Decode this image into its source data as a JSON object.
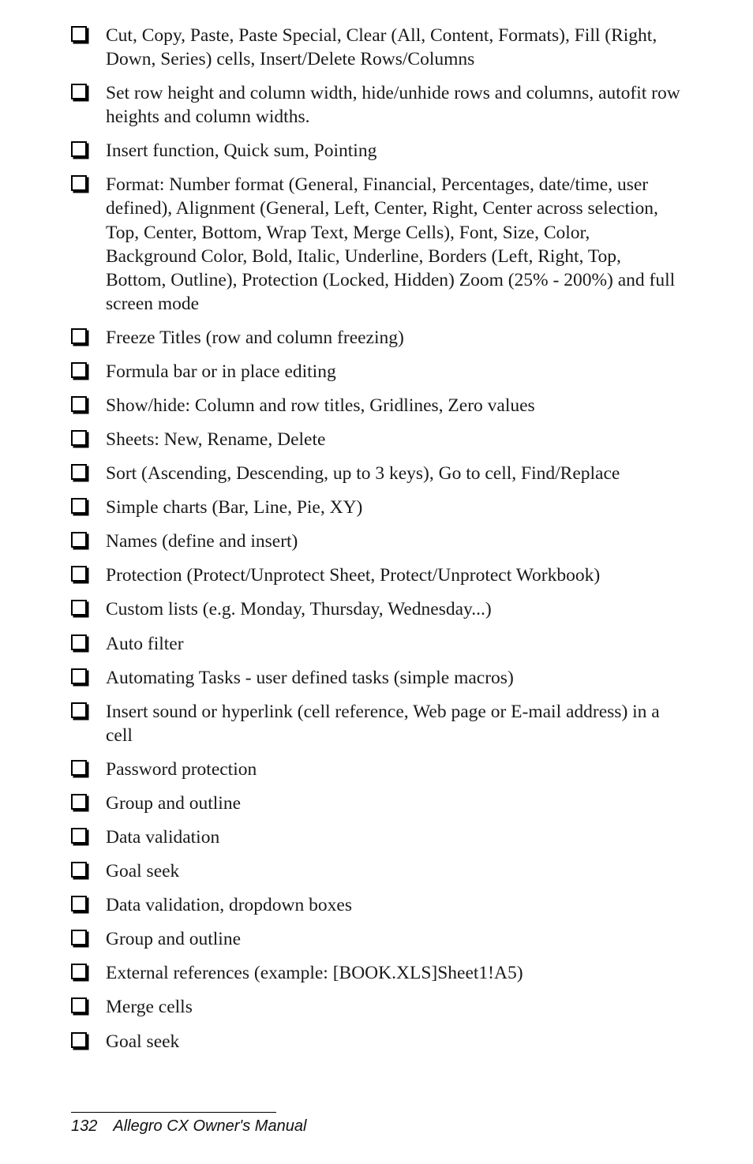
{
  "items": [
    "Cut, Copy, Paste, Paste Special, Clear (All, Content, Formats), Fill (Right, Down, Series) cells, Insert/Delete Rows/Columns",
    "Set row height and column width, hide/unhide rows and columns, autofit row heights and column widths.",
    "Insert function, Quick sum, Pointing",
    "Format: Number format (General, Financial, Percentages, date/time, user defined),   Alignment (General, Left, Center, Right, Center across selection, Top, Center, Bottom,  Wrap Text, Merge Cells), Font, Size, Color, Background Color, Bold, Italic, Underline, Borders (Left, Right, Top, Bottom, Outline), Protection (Locked, Hidden)  Zoom (25% - 200%) and full screen mode",
    "Freeze Titles (row and column freezing)",
    "Formula bar or in place editing",
    "Show/hide: Column and row titles, Gridlines, Zero values",
    "Sheets: New, Rename, Delete",
    "Sort (Ascending, Descending, up to 3 keys), Go to cell, Find/Replace",
    "Simple charts (Bar, Line, Pie, XY)",
    "Names (define and insert)",
    "Protection (Protect/Unprotect Sheet, Protect/Unprotect Workbook)",
    "Custom lists (e.g. Monday, Thursday, Wednesday...)",
    "Auto filter",
    "Automating Tasks - user defined tasks (simple macros)",
    "Insert sound or hyperlink (cell reference, Web page or E-mail address)  in a cell",
    "Password protection",
    "Group and outline",
    "Data validation",
    "Goal seek",
    "Data validation, dropdown boxes",
    "Group and outline",
    "External references (example: [BOOK.XLS]Sheet1!A5)",
    "Merge cells",
    "Goal seek"
  ],
  "footer": {
    "page_number": "132",
    "title": "Allegro CX Owner's Manual"
  }
}
